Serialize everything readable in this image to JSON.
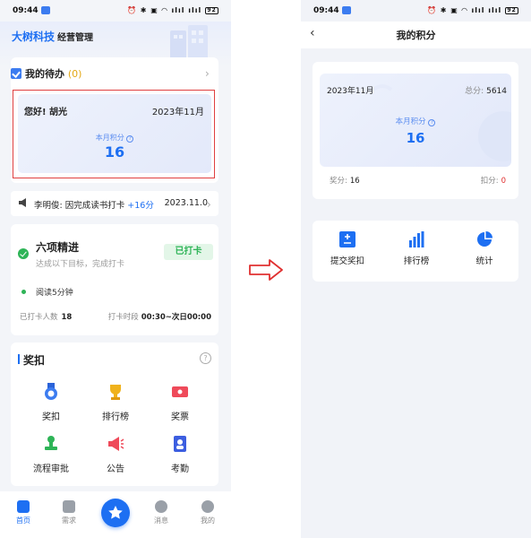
{
  "left": {
    "status": {
      "time": "09:44",
      "icons": "⏰ ✱ ▣ ◠ ılıl ılıl",
      "battery": "92"
    },
    "header": {
      "brand": "大树科技",
      "subtitle": "经营管理"
    },
    "todo": {
      "label": "我的待办",
      "count": "(0)"
    },
    "points": {
      "greeting": "您好! 胡光",
      "month": "2023年11月",
      "label": "本月积分",
      "help": "?",
      "value": "16"
    },
    "news": {
      "text": "李明俊: 因完成读书打卡",
      "plus": "+16分",
      "date": "2023.11.0"
    },
    "task": {
      "title": "六项精进",
      "subtitle": "达成以下目标，完成打卡",
      "button": "已打卡",
      "item": "阅读5分钟",
      "count_label": "已打卡人数",
      "count_value": "18",
      "time_label": "打卡时段",
      "time_value": "00:30~次日00:00"
    },
    "reward": {
      "title": "奖扣",
      "help": "?",
      "items": [
        {
          "label": "奖扣",
          "icon": "medal-icon"
        },
        {
          "label": "排行榜",
          "icon": "trophy-icon"
        },
        {
          "label": "奖票",
          "icon": "ticket-icon"
        },
        {
          "label": "流程审批",
          "icon": "stamp-icon"
        },
        {
          "label": "公告",
          "icon": "megaphone-icon"
        },
        {
          "label": "考勤",
          "icon": "badge-icon"
        }
      ]
    },
    "tabs": [
      {
        "label": "首页",
        "active": true
      },
      {
        "label": "需求",
        "active": false
      },
      {
        "label": "消息",
        "active": false
      },
      {
        "label": "我的",
        "active": false
      }
    ]
  },
  "right": {
    "status": {
      "time": "09:44",
      "icons": "⏰ ✱ ▣ ◠ ılıl ılıl",
      "battery": "92"
    },
    "nav": {
      "back": "‹",
      "title": "我的积分"
    },
    "card": {
      "month": "2023年11月",
      "total_label": "总分:",
      "total_value": "5614",
      "label": "本月积分",
      "help": "?",
      "value": "16",
      "award_label": "奖分:",
      "award_value": "16",
      "deduct_label": "扣分:",
      "deduct_value": "0"
    },
    "menu": [
      {
        "label": "提交奖扣",
        "icon": "plus-minus-icon"
      },
      {
        "label": "排行榜",
        "icon": "bar-chart-icon"
      },
      {
        "label": "统计",
        "icon": "pie-chart-icon"
      }
    ]
  },
  "colors": {
    "accent": "#1d6ff2",
    "highlight": "#e04040",
    "success": "#2eb457",
    "warning": "#e4a814"
  }
}
